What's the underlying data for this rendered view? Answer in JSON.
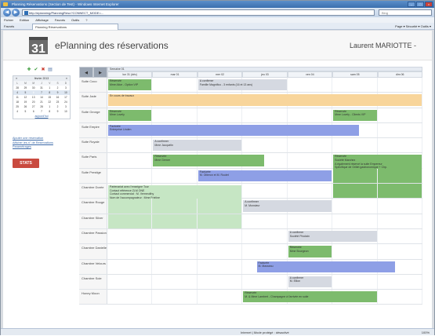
{
  "browser": {
    "title": "Planning Réservations (Section de Test) - Windows Internet Explorer",
    "url": "http://eplanning/PlanningReso?CONNECT_MODE=...",
    "search_placeholder": "Bing",
    "menu": [
      "Fichier",
      "Edition",
      "Affichage",
      "Favoris",
      "Outils",
      "?"
    ],
    "favorites_label": "Favoris",
    "tab_label": "Planning Réservations",
    "tools": "Page ▾   Sécurité ▾   Outils ▾",
    "status_text": "Internet | Mode protégé : désactivé",
    "zoom": "100%"
  },
  "app": {
    "logo": "31",
    "title": "ePlanning des réservations",
    "user": "Laurent MARIOTTE -"
  },
  "sidebar": {
    "calendar_month": "février 2013",
    "dow": [
      "L",
      "M",
      "M",
      "J",
      "V",
      "S",
      "D"
    ],
    "days": [
      [
        "28",
        "29",
        "30",
        "31",
        "1",
        "2",
        "3"
      ],
      [
        "4",
        "5",
        "6",
        "7",
        "8",
        "9",
        "10"
      ],
      [
        "11",
        "12",
        "13",
        "14",
        "15",
        "16",
        "17"
      ],
      [
        "18",
        "19",
        "20",
        "21",
        "22",
        "23",
        "24"
      ],
      [
        "25",
        "26",
        "27",
        "28",
        "1",
        "2",
        "3"
      ],
      [
        "4",
        "5",
        "6",
        "7",
        "8",
        "9",
        "10"
      ]
    ],
    "today_link": "aujourd'hui",
    "side_link": "Ajouter une réservation\nAfficher les n° de Réservations\nParamétrages",
    "stats_label": "STATS"
  },
  "planning": {
    "week_label": "Semaine 01",
    "days": [
      "lun 31 (déc)",
      "mar 01",
      "mer 02",
      "jeu 03",
      "ven 04",
      "sam 05",
      "dim 06"
    ],
    "rooms": [
      "Suite Coco",
      "Suite Jade",
      "Suite George",
      "Suite Empire",
      "Suite Royale",
      "Suite Paris",
      "Suite Prestige",
      "Chambre Dorée",
      "Chambre Rouge",
      "Chambre Silver",
      "Chambre Passion",
      "Chambre Danielle",
      "Chambre Velours",
      "Chambre Soie",
      "Honey Moon"
    ],
    "bookings": [
      {
        "row": 0,
        "start": 0,
        "end": 1,
        "color": "green",
        "line1": "Réservée",
        "line2": "Mme Alice - Option VIP"
      },
      {
        "row": 0,
        "start": 2,
        "end": 4,
        "color": "gray",
        "line1": "A confirmer",
        "line2": "Famille Magnifico - 3 enfants (16 et 13 ans)"
      },
      {
        "row": 1,
        "start": 0,
        "end": 7,
        "color": "orange",
        "line1": "En cours de travaux",
        "line2": ""
      },
      {
        "row": 2,
        "start": 0,
        "end": 1,
        "color": "green",
        "line1": "Réservée",
        "line2": "Mme Lovely"
      },
      {
        "row": 2,
        "start": 5,
        "end": 6,
        "color": "green",
        "line1": "Réservée",
        "line2": "Mme Lovely - Clients VIP"
      },
      {
        "row": 3,
        "start": 0,
        "end": 5.6,
        "color": "blue",
        "line1": "Facturée",
        "line2": "Entreprise Linden"
      },
      {
        "row": 4,
        "start": 1,
        "end": 3,
        "color": "gray",
        "line1": "A confirmer",
        "line2": "Mme Jacquelin"
      },
      {
        "row": 5,
        "start": 1,
        "end": 3.5,
        "color": "green",
        "line1": "Réservée",
        "line2": "Mme Gerner"
      },
      {
        "row": 5,
        "start": 5,
        "end": 7,
        "color": "green",
        "line1": "Réservée",
        "line2": "Société Marchez",
        "line3": "A également réservé la suite Empereur",
        "line4": "Spécifique de Grillet gastronomique + Chp."
      },
      {
        "row": 6,
        "start": 2,
        "end": 5,
        "color": "blue",
        "line1": "Facturée",
        "line2": "M. Ollieron et M. Routet"
      },
      {
        "row": 7,
        "start": 0,
        "end": 3,
        "color": "light",
        "line1": "Partenariat avec l'enseigne Tour",
        "line2": "Contact référence ZLM ONE",
        "line3": "Contact commercial : M. Vermeulthy",
        "line4": "Nom de l'accompagnateur : Mme Frieline"
      },
      {
        "row": 8,
        "start": 3,
        "end": 5,
        "color": "gray",
        "line1": "A confirmer",
        "line2": "M. Monsieur"
      },
      {
        "row": 10,
        "start": 4,
        "end": 6,
        "color": "gray",
        "line1": "A confirmer",
        "line2": "Société Pinotain"
      },
      {
        "row": 11,
        "start": 4,
        "end": 5,
        "color": "green",
        "line1": "Réservée",
        "line2": "Mme Bourgeon"
      },
      {
        "row": 12,
        "start": 3.3,
        "end": 6.4,
        "color": "blue",
        "line1": "Facturée",
        "line2": "M. Masseau"
      },
      {
        "row": 13,
        "start": 4,
        "end": 5,
        "color": "gray",
        "line1": "A confirmer",
        "line2": "M. Ellion"
      },
      {
        "row": 14,
        "start": 3,
        "end": 6,
        "color": "green",
        "line1": "Réservée",
        "line2": "M. & Mme Lambert - Champagne à l'arrivée en suite"
      }
    ]
  },
  "colors": {
    "reserved": "#7dbb6d",
    "to_confirm": "#d5d9e1",
    "invoiced": "#8e9fe6",
    "works": "#f8d59b",
    "partnership": "#c6e6c4",
    "stats_button": "#c94a3f"
  }
}
